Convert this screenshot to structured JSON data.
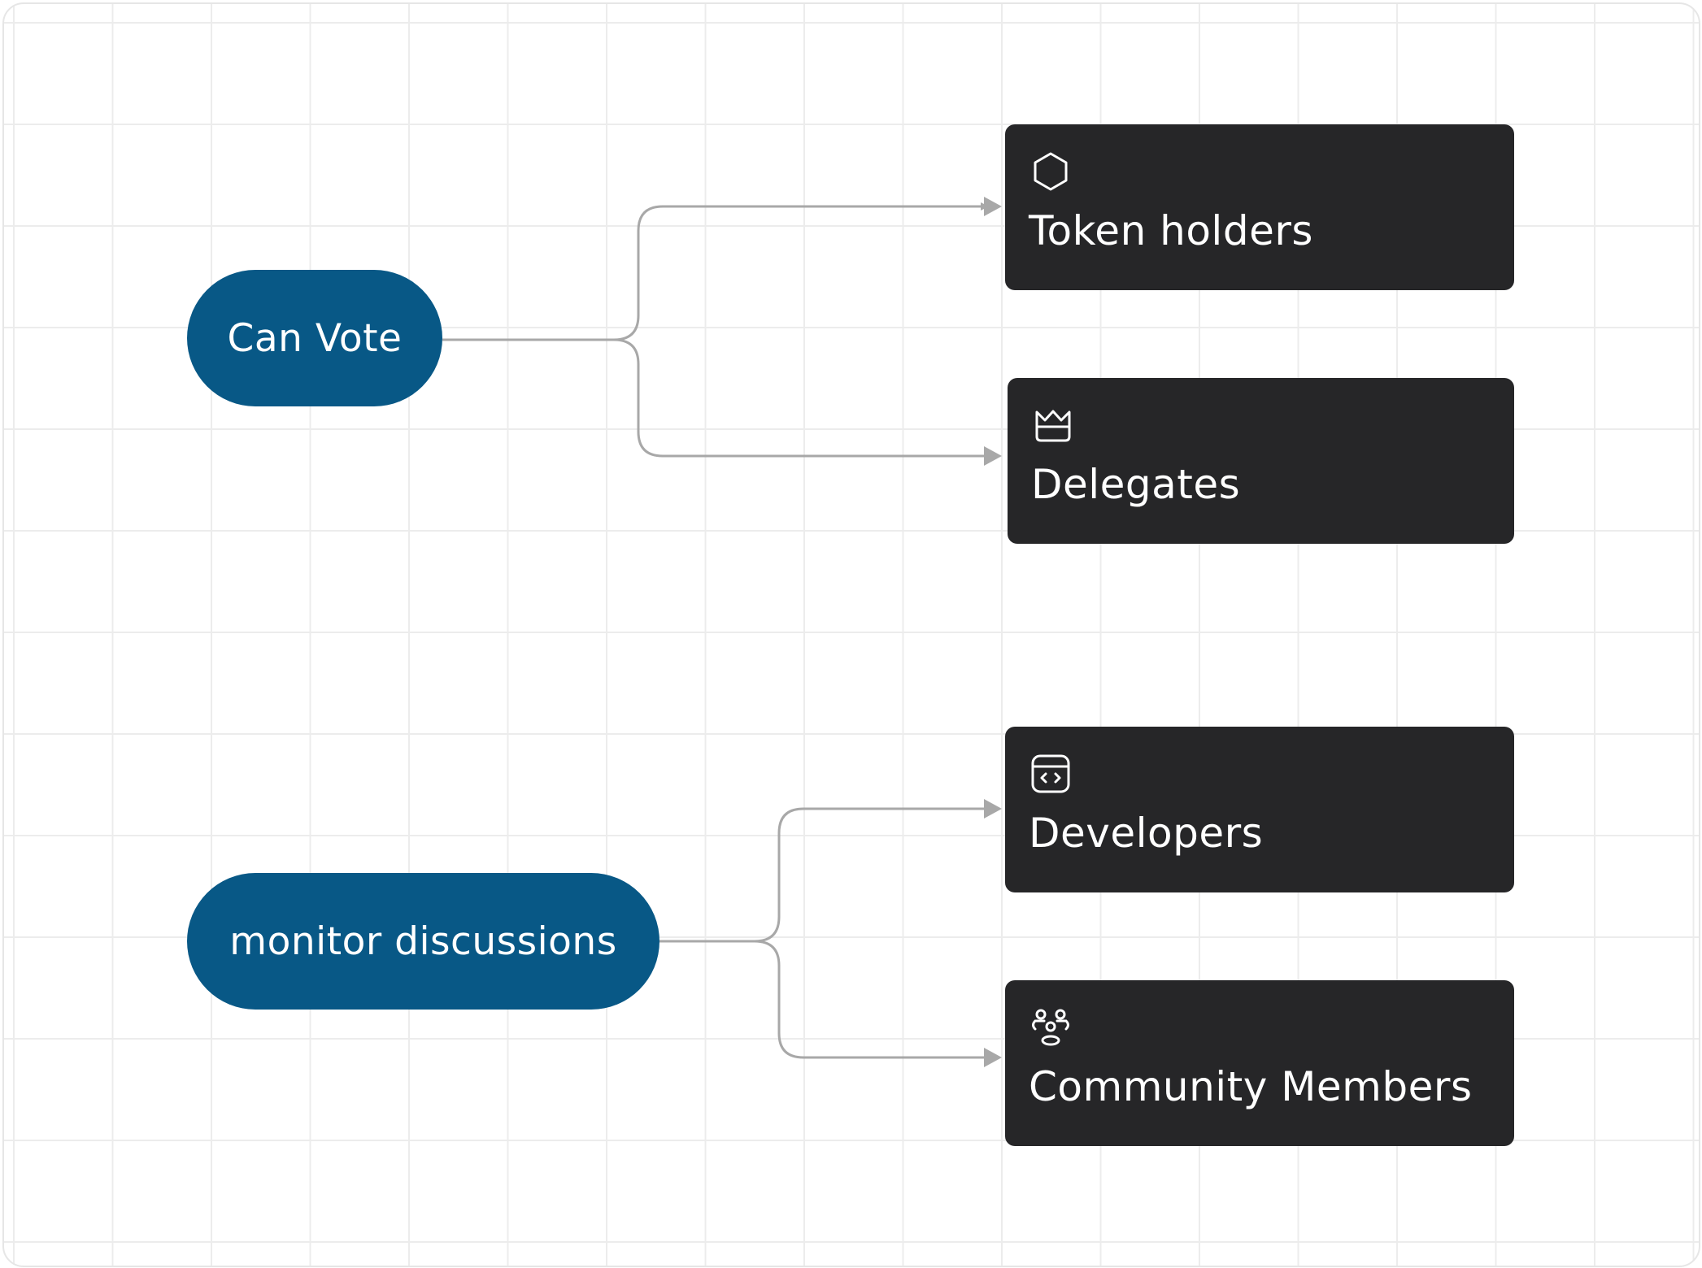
{
  "diagram": {
    "sources": [
      {
        "label": "Can Vote"
      },
      {
        "label": "monitor discussions"
      }
    ],
    "targets": [
      {
        "label": "Token holders",
        "icon": "hexagon-icon"
      },
      {
        "label": "Delegates",
        "icon": "crown-icon"
      },
      {
        "label": "Developers",
        "icon": "code-window-icon"
      },
      {
        "label": "Community Members",
        "icon": "users-group-icon"
      }
    ],
    "edges": [
      {
        "from": "Can Vote",
        "to": "Token holders"
      },
      {
        "from": "Can Vote",
        "to": "Delegates"
      },
      {
        "from": "monitor discussions",
        "to": "Developers"
      },
      {
        "from": "monitor discussions",
        "to": "Community Members"
      }
    ],
    "colors": {
      "source_fill": "#085886",
      "target_fill": "#262628",
      "text": "#ffffff",
      "edge": "#a8a8a8",
      "grid": "#ececec"
    }
  }
}
